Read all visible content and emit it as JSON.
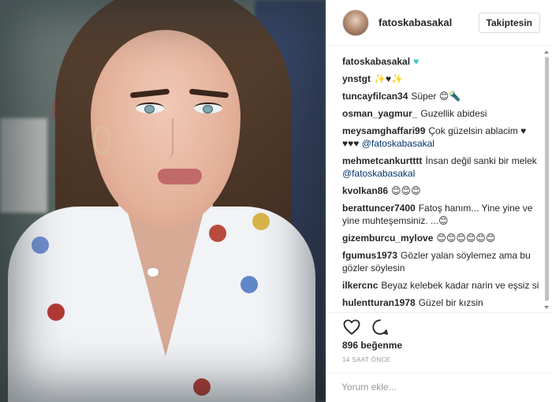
{
  "header": {
    "username": "fatoskabasakal",
    "follow_label": "Takiptesin"
  },
  "caption": {
    "user": "fatoskabasakal",
    "text": "♥"
  },
  "comments": [
    {
      "user": "ynstgt",
      "text": "✨♥✨"
    },
    {
      "user": "tuncayfilcan34",
      "text": "Süper 😊🔦"
    },
    {
      "user": "osman_yagmur_",
      "text": "Guzellik abidesi"
    },
    {
      "user": "meysamghaffari99",
      "text": "Çok güzelsin ablacim ♥ ♥♥♥",
      "mention": "@fatoskabasakal"
    },
    {
      "user": "mehmetcankurtttt",
      "text": "İnsan değil sanki bir melek",
      "mention": "@fatoskabasakal"
    },
    {
      "user": "kvolkan86",
      "text": "😊😊😊"
    },
    {
      "user": "berattuncer7400",
      "text": "Fatoş hanım... Yine yine ve yine muhteşemsiniz. ...😊"
    },
    {
      "user": "gizemburcu_mylove",
      "text": "😊😊😊😊😊😊"
    },
    {
      "user": "fgumus1973",
      "text": "Gözler yalan söylemez ama bu gözler söylesin"
    },
    {
      "user": "ilkercnc",
      "text": "Beyaz kelebek kadar narin ve eşsiz si"
    },
    {
      "user": "hulentturan1978",
      "text": "Güzel bir kızsin"
    }
  ],
  "actions": {
    "like_icon": "heart-outline-icon",
    "comment_icon": "speech-bubble-icon"
  },
  "likes": "896 beğenme",
  "timestamp": "14 SAAT ÖNCE",
  "comment_box": {
    "placeholder": "Yorum ekle..."
  }
}
